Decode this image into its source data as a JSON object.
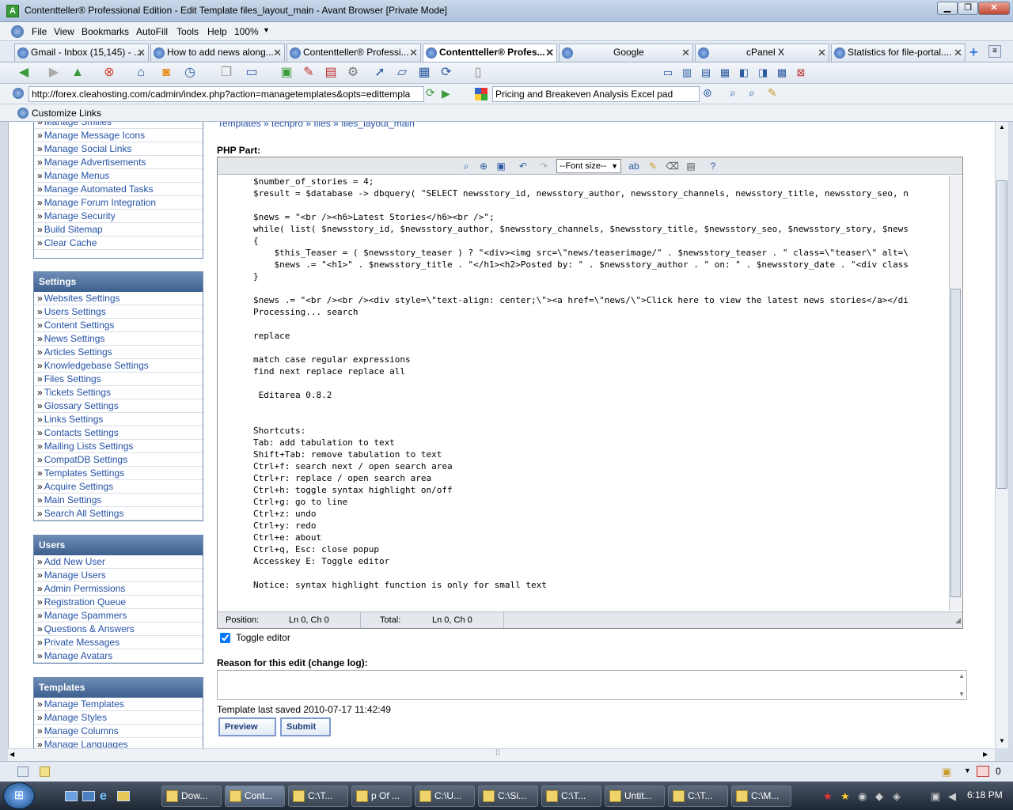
{
  "window": {
    "title": "Contentteller® Professional Edition - Edit Template files_layout_main - Avant Browser [Private Mode]",
    "app_icon": "A",
    "minimize": "▁",
    "maximize": "❐",
    "close": "✕"
  },
  "menu": [
    "File",
    "View",
    "Bookmarks",
    "AutoFill",
    "Tools",
    "Help",
    "100%"
  ],
  "tabs": [
    {
      "label": "Gmail - Inbox (15,145) - ..."
    },
    {
      "label": "How to add news along..."
    },
    {
      "label": "Contentteller® Professi..."
    },
    {
      "label": "Contentteller® Profes...",
      "active": true
    },
    {
      "label": "Google"
    },
    {
      "label": "cPanel X"
    },
    {
      "label": "Statistics for file-portal...."
    }
  ],
  "address": {
    "url": "http://forex.cleahosting.com/cadmin/index.php?action=managetemplates&opts=edittempla",
    "search": "Pricing and Breakeven Analysis Excel pad"
  },
  "links_bar": {
    "label": "Customize Links"
  },
  "sidebar": {
    "top_items": [
      "Manage Smilies",
      "Manage Message Icons",
      "Manage Social Links",
      "Manage Advertisements",
      "Manage Menus",
      "Manage Automated Tasks",
      "Manage Forum Integration",
      "Manage Security",
      "Build Sitemap",
      "Clear Cache"
    ],
    "settings": {
      "title": "Settings",
      "items": [
        "Websites Settings",
        "Users Settings",
        "Content Settings",
        "News Settings",
        "Articles Settings",
        "Knowledgebase Settings",
        "Files Settings",
        "Tickets Settings",
        "Glossary Settings",
        "Links Settings",
        "Contacts Settings",
        "Mailing Lists Settings",
        "CompatDB Settings",
        "Templates Settings",
        "Acquire Settings",
        "Main Settings",
        "Search All Settings"
      ]
    },
    "users": {
      "title": "Users",
      "items": [
        "Add New User",
        "Manage Users",
        "Admin Permissions",
        "Registration Queue",
        "Manage Spammers",
        "Questions & Answers",
        "Private Messages",
        "Manage Avatars"
      ]
    },
    "templates": {
      "title": "Templates",
      "items": [
        "Manage Templates",
        "Manage Styles",
        "Manage Columns",
        "Manage Languages"
      ]
    }
  },
  "main": {
    "breadcrumb": "Templates » techpro » files » files_layout_main",
    "php_part_label": "PHP Part:",
    "font_size_select": "--Font size--",
    "code_lines": [
      "$number_of_stories = 4;",
      "$result = $database -> dbquery( \"SELECT newsstory_id, newsstory_author, newsstory_channels, newsstory_title, newsstory_seo, n",
      "",
      "$news = \"<br /><h6>Latest Stories</h6><br />\";",
      "while( list( $newsstory_id, $newsstory_author, $newsstory_channels, $newsstory_title, $newsstory_seo, $newsstory_story, $news",
      "{",
      "    $this_Teaser = ( $newsstory_teaser ) ? \"<div><img src=\\\"news/teaserimage/\" . $newsstory_teaser . \" class=\\\"teaser\\\" alt=\\",
      "    $news .= \"<h1>\" . $newsstory_title . \"</h1><h2>Posted by: \" . $newsstory_author . \" on: \" . $newsstory_date . \"<div class",
      "}",
      "",
      "$news .= \"<br /><br /><div style=\\\"text-align: center;\\\"><a href=\\\"news/\\\">Click here to view the latest news stories</a></di",
      "Processing... search",
      "",
      "replace",
      "",
      "match case regular expressions",
      "find next replace replace all",
      "",
      " Editarea 0.8.2",
      "",
      "",
      "Shortcuts:",
      "Tab: add tabulation to text",
      "Shift+Tab: remove tabulation to text",
      "Ctrl+f: search next / open search area",
      "Ctrl+r: replace / open search area",
      "Ctrl+h: toggle syntax highlight on/off",
      "Ctrl+g: go to line",
      "Ctrl+z: undo",
      "Ctrl+y: redo",
      "Ctrl+e: about",
      "Ctrl+q, Esc: close popup",
      "Accesskey E: Toggle editor",
      "",
      "Notice: syntax highlight function is only for small text"
    ],
    "status": {
      "position_label": "Position:",
      "position_value": "Ln 0, Ch 0",
      "total_label": "Total:",
      "total_value": "Ln 0, Ch 0"
    },
    "toggle_editor_label": "Toggle editor",
    "toggle_editor_checked": true,
    "reason_label": "Reason for this edit (change log):",
    "reason_value": "",
    "saved_text": "Template last saved 2010-07-17 11:42:49",
    "preview_button": "Preview",
    "submit_button": "Submit"
  },
  "statusbar": {
    "count": "0"
  },
  "taskbar": {
    "items": [
      "Dow...",
      "Cont...",
      "C:\\T...",
      "p Of ...",
      "C:\\U...",
      "C:\\Si...",
      "C:\\T...",
      "Untit...",
      "C:\\T...",
      "C:\\M..."
    ],
    "clock": "6:18 PM"
  },
  "colors": {
    "accent": "#3c5f8e",
    "link": "#2451a6"
  }
}
